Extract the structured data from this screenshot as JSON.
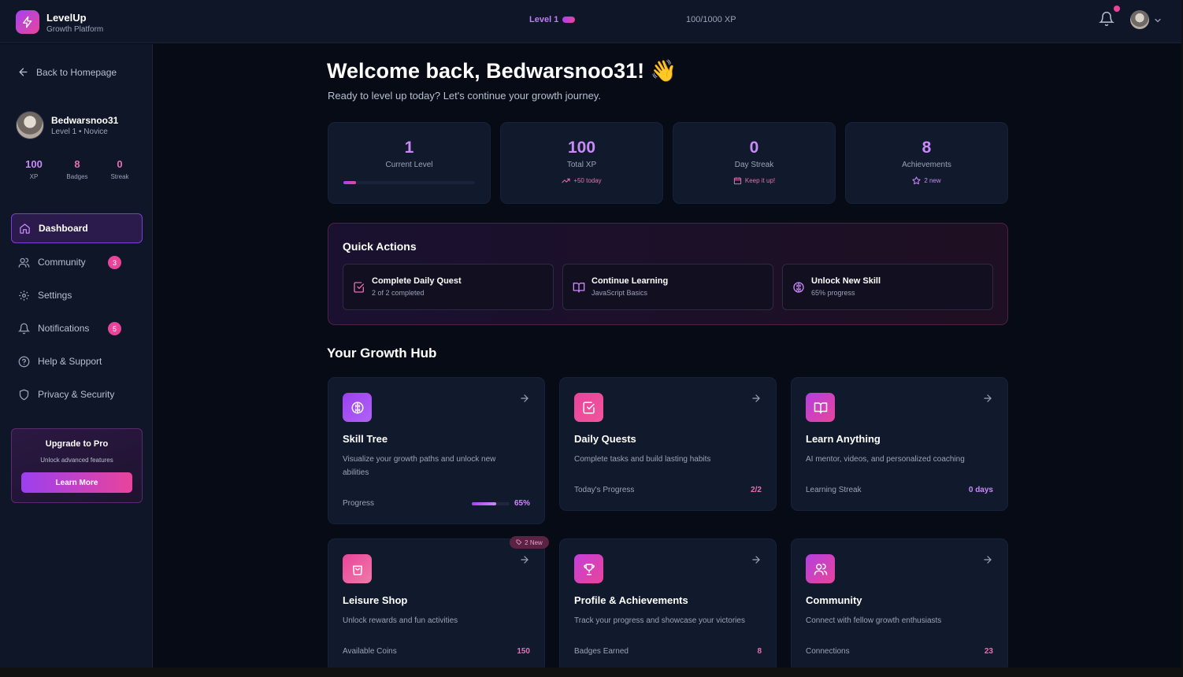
{
  "app": {
    "name": "LevelUp",
    "tagline": "Growth Platform"
  },
  "topbar": {
    "level_label": "Level 1",
    "xp_label": "100/1000 XP",
    "level_progress": 0.1
  },
  "sidebar": {
    "back_label": "Back to Homepage",
    "user": {
      "name": "Bedwarsnoo31",
      "level": "Level 1 • Novice"
    },
    "stats": [
      {
        "value": "100",
        "label": "XP",
        "color": "#c98af8"
      },
      {
        "value": "8",
        "label": "Badges",
        "color": "#e36fb4"
      },
      {
        "value": "0",
        "label": "Streak",
        "color": "#e36fb4"
      }
    ],
    "nav": [
      {
        "label": "Dashboard",
        "icon": "home-icon",
        "badge": ""
      },
      {
        "label": "Community",
        "icon": "users-icon",
        "badge": "3"
      },
      {
        "label": "Settings",
        "icon": "gear-icon",
        "badge": ""
      },
      {
        "label": "Notifications",
        "icon": "bell-icon",
        "badge": "5"
      },
      {
        "label": "Help & Support",
        "icon": "help-circle-icon",
        "badge": ""
      },
      {
        "label": "Privacy & Security",
        "icon": "shield-icon",
        "badge": ""
      }
    ],
    "upgrade": {
      "title": "Upgrade to Pro",
      "subtitle": "Unlock advanced features",
      "button": "Learn More"
    }
  },
  "main": {
    "welcome": "Welcome back, Bedwarsnoo31! 👋",
    "subtitle": "Ready to level up today? Let's continue your growth journey.",
    "stat_cards": [
      {
        "value": "1",
        "caption": "Current Level",
        "sub": "",
        "progress": 0.1
      },
      {
        "value": "100",
        "caption": "Total XP",
        "sub": "+50 today"
      },
      {
        "value": "0",
        "caption": "Day Streak",
        "sub": "Keep it up!"
      },
      {
        "value": "8",
        "caption": "Achievements",
        "sub": "2 new"
      }
    ],
    "quick_actions": {
      "title": "Quick Actions",
      "items": [
        {
          "title": "Complete Daily Quest",
          "subtitle": "2 of 2 completed",
          "icon": "check-square-icon"
        },
        {
          "title": "Continue Learning",
          "subtitle": "JavaScript Basics",
          "icon": "book-open-icon"
        },
        {
          "title": "Unlock New Skill",
          "subtitle": "65% progress",
          "icon": "brain-icon"
        }
      ]
    },
    "hub_title": "Your Growth Hub",
    "hub_cards": [
      {
        "name": "Skill Tree",
        "desc": "Visualize your growth paths and unlock new abilities",
        "foot_label": "Progress",
        "foot_value": "65%",
        "icon": "brain-icon",
        "progress": 0.65,
        "accent": "#c98af8"
      },
      {
        "name": "Daily Quests",
        "desc": "Complete tasks and build lasting habits",
        "foot_label": "Today's Progress",
        "foot_value": "2/2",
        "icon": "check-square-icon",
        "accent": "#e36fb4"
      },
      {
        "name": "Learn Anything",
        "desc": "AI mentor, videos, and personalized coaching",
        "foot_label": "Learning Streak",
        "foot_value": "0 days",
        "icon": "book-open-icon",
        "accent": "#c98af8"
      },
      {
        "name": "Leisure Shop",
        "desc": "Unlock rewards and fun activities",
        "foot_label": "Available Coins",
        "foot_value": "150",
        "icon": "shopping-bag-icon",
        "accent": "#e36fb4",
        "pill": "2 New"
      },
      {
        "name": "Profile & Achievements",
        "desc": "Track your progress and showcase your victories",
        "foot_label": "Badges Earned",
        "foot_value": "8",
        "icon": "trophy-icon",
        "accent": "#e36fb4"
      },
      {
        "name": "Community",
        "desc": "Connect with fellow growth enthusiasts",
        "foot_label": "Connections",
        "foot_value": "23",
        "icon": "users-icon",
        "accent": "#e36fb4"
      }
    ]
  }
}
